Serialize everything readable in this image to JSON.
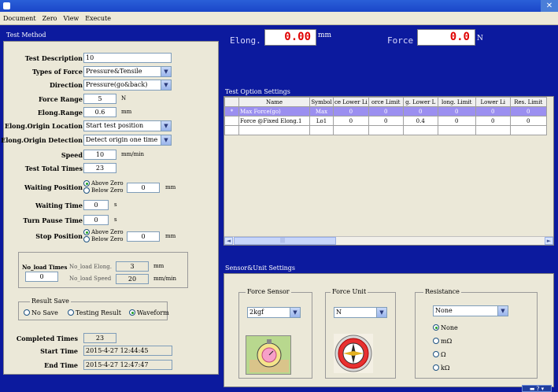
{
  "menu": [
    "Document",
    "Zero",
    "View",
    "Execute"
  ],
  "titlebar": {
    "close": "✕"
  },
  "left_title": "Test Method",
  "fields": {
    "test_description": {
      "label": "Test Description",
      "value": "10"
    },
    "types_of_force": {
      "label": "Types of Force",
      "value": "Pressure&Tensile"
    },
    "direction": {
      "label": "Direction",
      "value": "Pressure(go&back)"
    },
    "force_range": {
      "label": "Force Range",
      "value": "5",
      "unit": "N"
    },
    "elong_range": {
      "label": "Elong.Range",
      "value": "0.6",
      "unit": "mm"
    },
    "elong_origin_location": {
      "label": "Elong.Origin Location",
      "value": "Start test position"
    },
    "elong_origin_detection": {
      "label": "Elong.Origin Detection",
      "value": "Detect origin one time"
    },
    "speed": {
      "label": "Speed",
      "value": "10",
      "unit": "mm/min"
    },
    "test_total_times": {
      "label": "Test Total Times",
      "value": "23"
    },
    "waiting_position": {
      "label": "Waiting Position",
      "opt1": "Above Zero",
      "opt2": "Below Zero",
      "value": "0",
      "unit": "mm"
    },
    "waiting_time": {
      "label": "Waiting Time",
      "value": "0",
      "unit": "s"
    },
    "turn_pause_time": {
      "label": "Turn Pause Time",
      "value": "0",
      "unit": "s"
    },
    "stop_position": {
      "label": "Stop Position",
      "opt1": "Above Zero",
      "opt2": "Below Zero",
      "value": "0",
      "unit": "mm"
    }
  },
  "noload": {
    "times_label": "No_load Times",
    "times_value": "0",
    "elong_label": "No_load Elong.",
    "elong_value": "3",
    "elong_unit": "mm",
    "speed_label": "No_load Speed",
    "speed_value": "20",
    "speed_unit": "mm/min"
  },
  "result_save": {
    "title": "Result Save",
    "opt1": "No Save",
    "opt2": "Testing Result",
    "opt3": "Waveform",
    "selected": "Waveform"
  },
  "status": {
    "completed_label": "Completed Times",
    "completed_value": "23",
    "start_label": "Start Time",
    "start_value": "2015-4-27 12:44:45",
    "end_label": "End Time",
    "end_value": "2015-4-27 12:47:47"
  },
  "displays": {
    "elong_label": "Elong.",
    "elong_value": "0.00",
    "elong_unit": "mm",
    "force_label": "Force",
    "force_value": "0.0",
    "force_unit": "N"
  },
  "table_title": "Test Option Settings",
  "table": {
    "headers": [
      "",
      "Name",
      "Symbol",
      "ce Lower Li",
      "orce Limit",
      "g. Lower L",
      "long. Limit",
      "Lower Li",
      "Res. Limit"
    ],
    "rows": [
      [
        "*",
        "Max Force(go)",
        "Max",
        "0",
        "0",
        "0",
        "0",
        "0",
        "0"
      ],
      [
        "",
        "Force @Fixed Elong.1",
        "Lo1",
        "0",
        "0",
        "0.4",
        "0",
        "0",
        "0"
      ]
    ]
  },
  "scroll": {
    "left": "◄",
    "grip": "|||",
    "right": "►"
  },
  "sensor_title": "Sensor&Unit Settings",
  "sensor": {
    "force_sensor_title": "Force Sensor",
    "force_sensor_value": "2kgf",
    "force_unit_title": "Force Unit",
    "force_unit_value": "N",
    "resistance_title": "Resistance",
    "resistance_value": "None",
    "res_opts": [
      "None",
      "mΩ",
      "Ω",
      "kΩ"
    ],
    "res_selected": "None"
  },
  "tray": {
    "text": "▬ ? ▾"
  },
  "colors": {
    "background": "#0c1a9e",
    "panel": "#ebe8d8",
    "display_text": "#e00000",
    "selected_row": "#9b8ff0"
  }
}
